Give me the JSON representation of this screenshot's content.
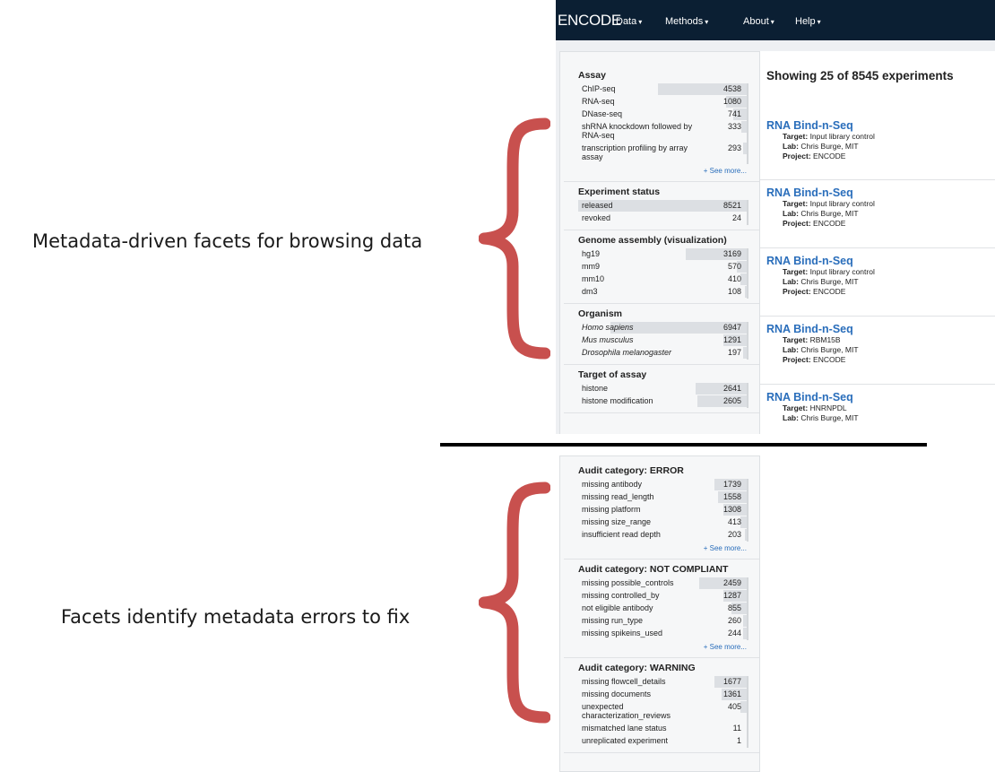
{
  "captions": {
    "top": "Metadata-driven facets for browsing data",
    "bottom": "Facets identify metadata errors to fix"
  },
  "navbar": {
    "brand": "ENCODE",
    "items": [
      "Data",
      "Methods",
      "About",
      "Help"
    ]
  },
  "facets_top": [
    {
      "title": "Assay",
      "terms": [
        {
          "label": "ChIP-seq",
          "count": "4538",
          "fraction": 0.53
        },
        {
          "label": "RNA-seq",
          "count": "1080",
          "fraction": 0.13
        },
        {
          "label": "DNase-seq",
          "count": "741",
          "fraction": 0.09
        },
        {
          "label": "shRNA knockdown followed by RNA-seq",
          "count": "333",
          "fraction": 0.04,
          "tall": true
        },
        {
          "label": "transcription profiling by array assay",
          "count": "293",
          "fraction": 0.03,
          "tall": true
        }
      ],
      "see_more": "+ See more..."
    },
    {
      "title": "Experiment status",
      "terms": [
        {
          "label": "released",
          "count": "8521",
          "fraction": 1.0
        },
        {
          "label": "revoked",
          "count": "24",
          "fraction": 0.01
        }
      ]
    },
    {
      "title": "Genome assembly (visualization)",
      "terms": [
        {
          "label": "hg19",
          "count": "3169",
          "fraction": 0.37
        },
        {
          "label": "mm9",
          "count": "570",
          "fraction": 0.07
        },
        {
          "label": "mm10",
          "count": "410",
          "fraction": 0.05
        },
        {
          "label": "dm3",
          "count": "108",
          "fraction": 0.02
        }
      ]
    },
    {
      "title": "Organism",
      "italic": true,
      "terms": [
        {
          "label": "Homo sapiens",
          "count": "6947",
          "fraction": 0.81
        },
        {
          "label": "Mus musculus",
          "count": "1291",
          "fraction": 0.15
        },
        {
          "label": "Drosophila melanogaster",
          "count": "197",
          "fraction": 0.03
        }
      ]
    },
    {
      "title": "Target of assay",
      "terms": [
        {
          "label": "histone",
          "count": "2641",
          "fraction": 0.31
        },
        {
          "label": "histone modification",
          "count": "2605",
          "fraction": 0.3
        }
      ]
    }
  ],
  "facets_bottom": [
    {
      "title": "Audit category: ERROR",
      "terms": [
        {
          "label": "missing antibody",
          "count": "1739",
          "fraction": 0.2
        },
        {
          "label": "missing read_length",
          "count": "1558",
          "fraction": 0.18
        },
        {
          "label": "missing platform",
          "count": "1308",
          "fraction": 0.15
        },
        {
          "label": "missing size_range",
          "count": "413",
          "fraction": 0.05
        },
        {
          "label": "insufficient read depth",
          "count": "203",
          "fraction": 0.02
        }
      ],
      "see_more": "+ See more..."
    },
    {
      "title": "Audit category: NOT COMPLIANT",
      "terms": [
        {
          "label": "missing possible_controls",
          "count": "2459",
          "fraction": 0.29
        },
        {
          "label": "missing controlled_by",
          "count": "1287",
          "fraction": 0.15
        },
        {
          "label": "not eligible antibody",
          "count": "855",
          "fraction": 0.1
        },
        {
          "label": "missing run_type",
          "count": "260",
          "fraction": 0.03
        },
        {
          "label": "missing spikeins_used",
          "count": "244",
          "fraction": 0.03
        }
      ],
      "see_more": "+ See more..."
    },
    {
      "title": "Audit category: WARNING",
      "terms": [
        {
          "label": "missing flowcell_details",
          "count": "1677",
          "fraction": 0.2
        },
        {
          "label": "missing documents",
          "count": "1361",
          "fraction": 0.16
        },
        {
          "label": "unexpected characterization_reviews",
          "count": "405",
          "fraction": 0.05,
          "tall": true
        },
        {
          "label": "mismatched lane status",
          "count": "11",
          "fraction": 0.01
        },
        {
          "label": "unreplicated experiment",
          "count": "1",
          "fraction": 0.0
        }
      ]
    }
  ],
  "results": {
    "showing": "Showing 25 of 8545 experiments",
    "items": [
      {
        "title": "RNA Bind-n-Seq",
        "lines": [
          {
            "key": "Target:",
            "value": "Input library control"
          },
          {
            "key": "Lab:",
            "value": "Chris Burge, MIT"
          },
          {
            "key": "Project:",
            "value": "ENCODE"
          }
        ]
      },
      {
        "title": "RNA Bind-n-Seq",
        "lines": [
          {
            "key": "Target:",
            "value": "Input library control"
          },
          {
            "key": "Lab:",
            "value": "Chris Burge, MIT"
          },
          {
            "key": "Project:",
            "value": "ENCODE"
          }
        ]
      },
      {
        "title": "RNA Bind-n-Seq",
        "lines": [
          {
            "key": "Target:",
            "value": "Input library control"
          },
          {
            "key": "Lab:",
            "value": "Chris Burge, MIT"
          },
          {
            "key": "Project:",
            "value": "ENCODE"
          }
        ]
      },
      {
        "title": "RNA Bind-n-Seq",
        "lines": [
          {
            "key": "Target:",
            "value": "RBM15B"
          },
          {
            "key": "Lab:",
            "value": "Chris Burge, MIT"
          },
          {
            "key": "Project:",
            "value": "ENCODE"
          }
        ]
      },
      {
        "title": "RNA Bind-n-Seq",
        "lines": [
          {
            "key": "Target:",
            "value": "HNRNPDL"
          },
          {
            "key": "Lab:",
            "value": "Chris Burge, MIT"
          }
        ]
      }
    ]
  },
  "colors": {
    "brace": "#c8504e",
    "navbar": "#0b1f33",
    "link": "#2a6ebb",
    "bar": "#dcdfe3"
  }
}
